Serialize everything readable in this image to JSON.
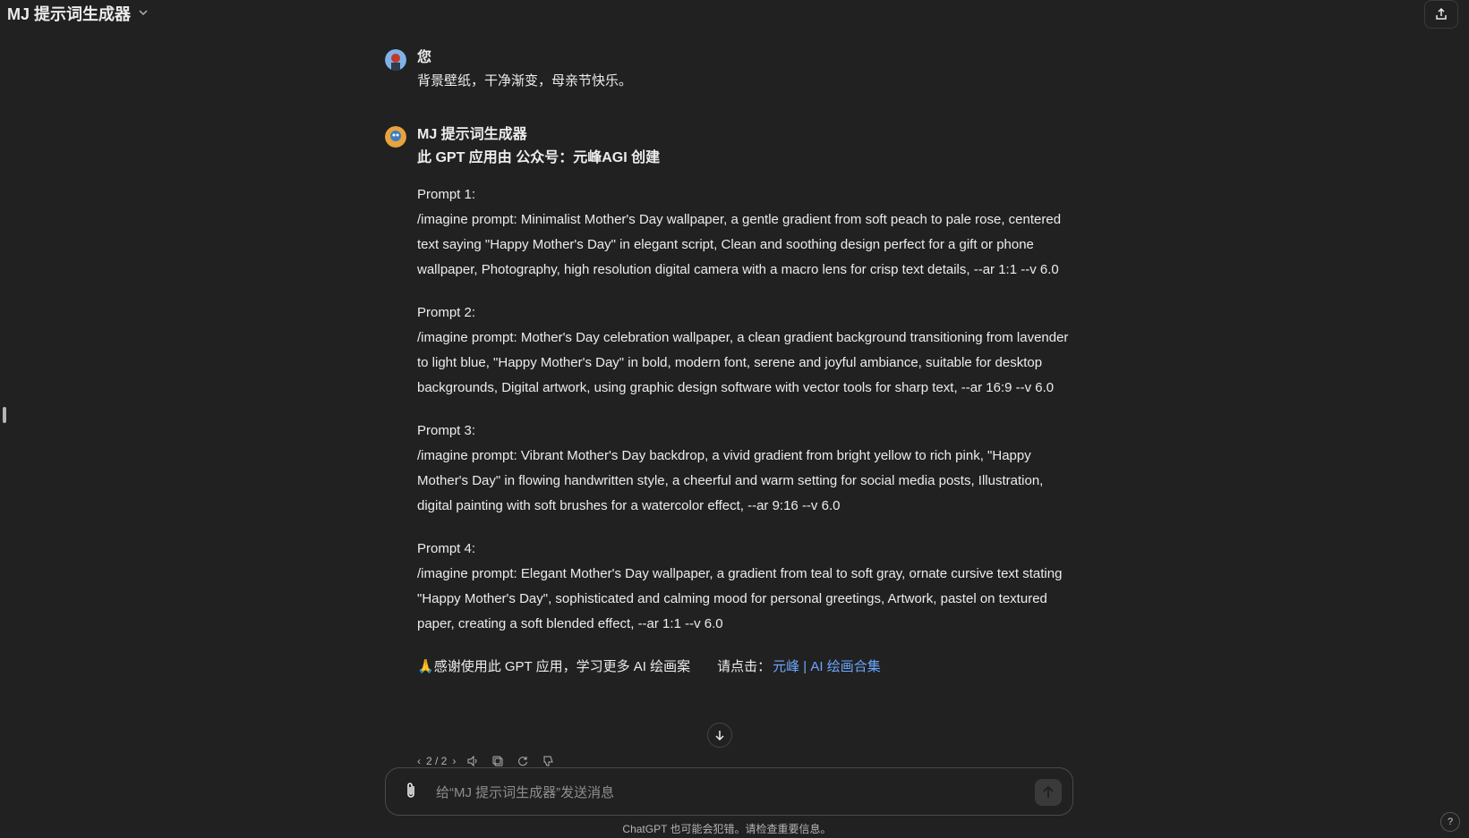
{
  "header": {
    "title": "MJ 提示词生成器",
    "title_icon": "chevron-down-icon",
    "share_icon": "share-icon"
  },
  "user_message": {
    "author": "您",
    "text": "背景壁纸，干净渐变，母亲节快乐。"
  },
  "bot_message": {
    "author": "MJ 提示词生成器",
    "subtitle": "此 GPT 应用由 公众号：元峰AGI 创建",
    "prompts": [
      {
        "label": "Prompt 1:",
        "text": "/imagine prompt: Minimalist Mother's Day wallpaper, a gentle gradient from soft peach to pale rose, centered text saying \"Happy Mother's Day\" in elegant script, Clean and soothing design perfect for a gift or phone wallpaper, Photography, high resolution digital camera with a macro lens for crisp text details, --ar 1:1 --v 6.0"
      },
      {
        "label": "Prompt 2:",
        "text": "/imagine prompt: Mother's Day celebration wallpaper, a clean gradient background transitioning from lavender to light blue, \"Happy Mother's Day\" in bold, modern font, serene and joyful ambiance, suitable for desktop backgrounds, Digital artwork, using graphic design software with vector tools for sharp text, --ar 16:9 --v 6.0"
      },
      {
        "label": "Prompt 3:",
        "text": "/imagine prompt: Vibrant Mother's Day backdrop, a vivid gradient from bright yellow to rich pink, \"Happy Mother's Day\" in flowing handwritten style, a cheerful and warm setting for social media posts, Illustration, digital painting with soft brushes for a watercolor effect, --ar 9:16 --v 6.0"
      },
      {
        "label": "Prompt 4:",
        "text": "/imagine prompt: Elegant Mother's Day wallpaper, a gradient from teal to soft gray, ornate cursive text stating \"Happy Mother's Day\", sophisticated and calming mood for personal greetings, Artwork, pastel on textured paper, creating a soft blended effect, --ar 1:1 --v 6.0"
      }
    ],
    "thanks_emoji": "🙏",
    "thanks_text": "感谢使用此 GPT 应用，学习更多 AI 绘画案",
    "thanks_text_after": "请点击：",
    "link_text": "元峰 | AI 绘画合集",
    "pager": "2 / 2"
  },
  "composer": {
    "placeholder": "给“MJ 提示词生成器”发送消息"
  },
  "footer": {
    "disclaimer": "ChatGPT 也可能会犯错。请检查重要信息。",
    "help": "?"
  },
  "colors": {
    "background": "#212121",
    "text": "#ececec",
    "link": "#6ca8ff",
    "muted": "#b4b4b4"
  }
}
